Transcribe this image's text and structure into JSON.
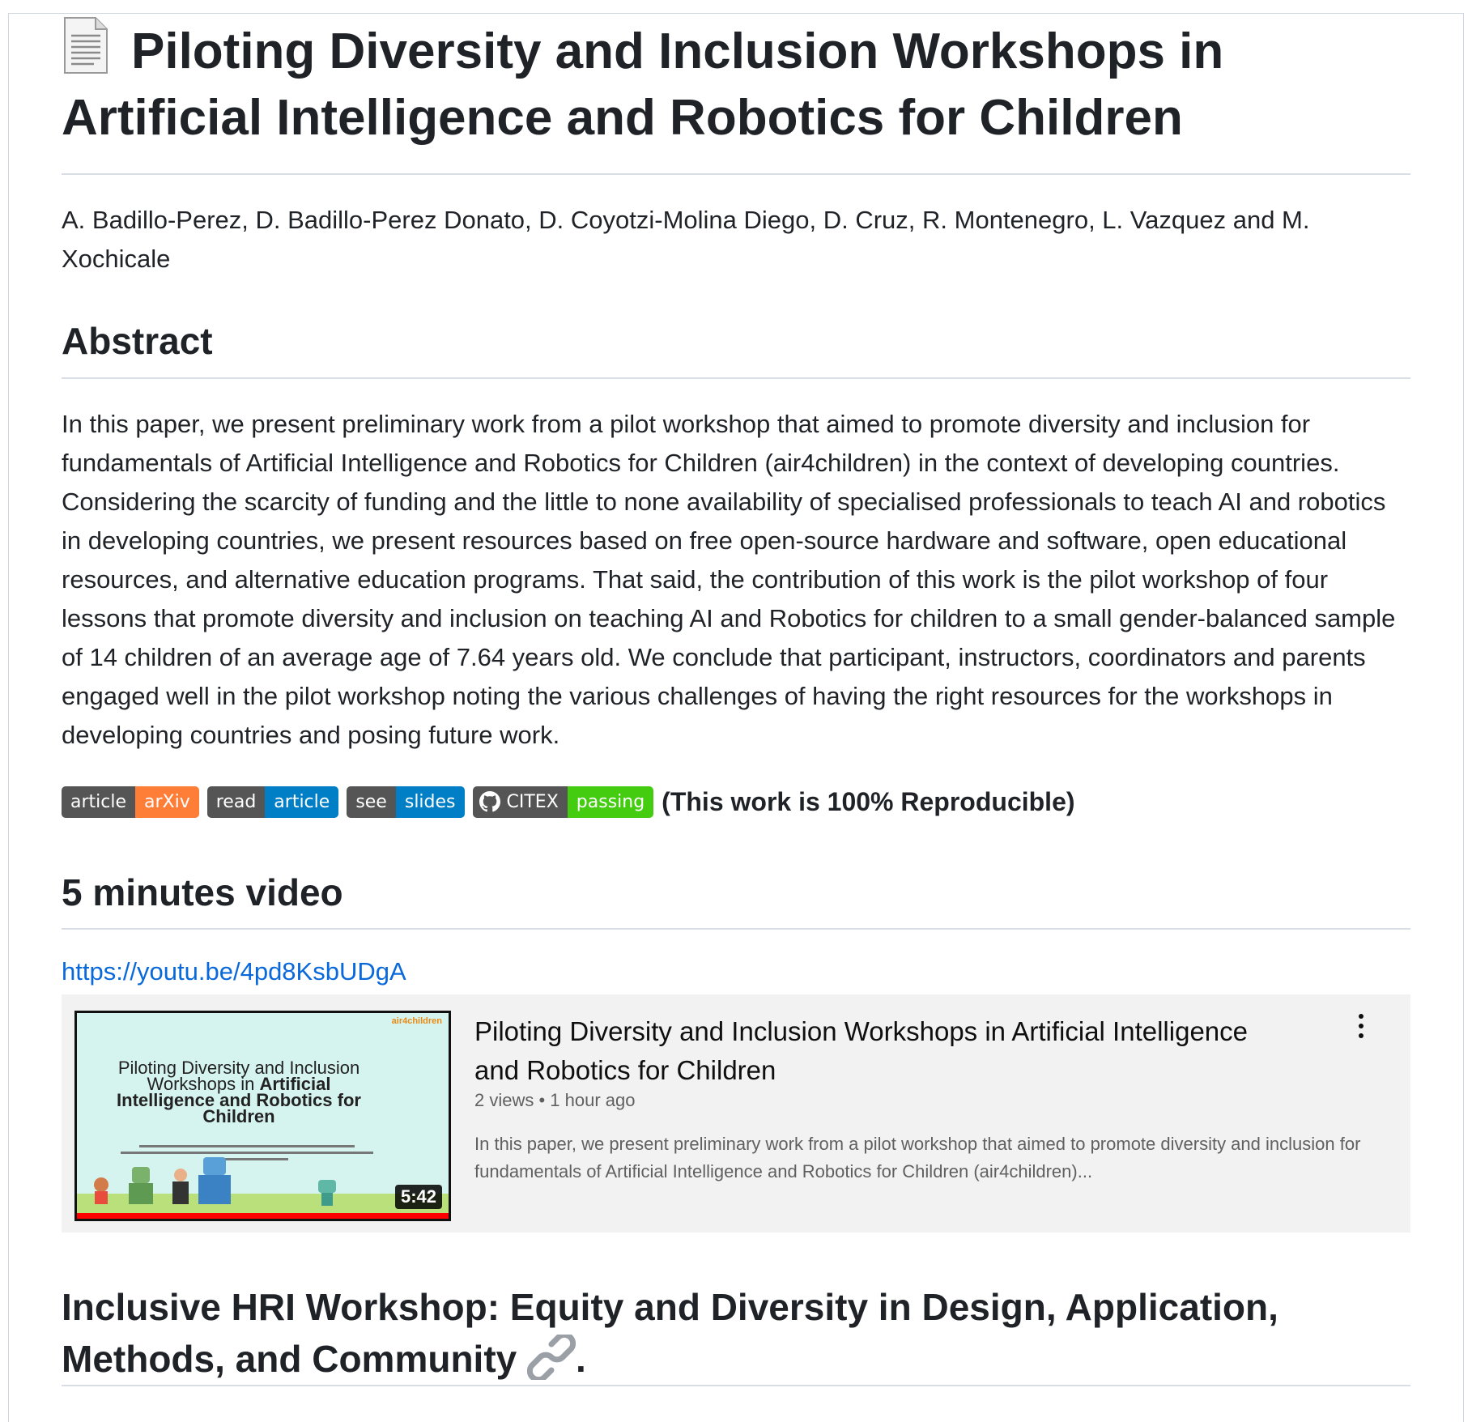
{
  "title": "Piloting Diversity and Inclusion Workshops in Artificial Intelligence and Robotics for Children",
  "title_icon": "page-icon",
  "authors": "A. Badillo-Perez, D. Badillo-Perez Donato, D. Coyotzi-Molina Diego, D. Cruz, R. Montenegro, L. Vazquez and M. Xochicale",
  "abstract_heading": "Abstract",
  "abstract": "In this paper, we present preliminary work from a pilot workshop that aimed to promote diversity and inclusion for fundamentals of Artificial Intelligence and Robotics for Children (air4children) in the context of developing countries. Considering the scarcity of funding and the little to none availability of specialised professionals to teach AI and robotics in developing countries, we present resources based on free open-source hardware and software, open educational resources, and alternative education programs. That said, the contribution of this work is the pilot workshop of four lessons that promote diversity and inclusion on teaching AI and Robotics for children to a small gender-balanced sample of 14 children of an average age of 7.64 years old. We conclude that participant, instructors, coordinators and parents engaged well in the pilot workshop noting the various challenges of having the right resources for the workshops in developing countries and posing future work.",
  "badges": [
    {
      "left": "article",
      "right": "arXiv",
      "color": "#fe7d37"
    },
    {
      "left": "read",
      "right": "article",
      "color": "#007ec6"
    },
    {
      "left": "see",
      "right": "slides",
      "color": "#007ec6"
    },
    {
      "left": "CITEX",
      "right": "passing",
      "color": "#4c1",
      "icon": "github-icon"
    }
  ],
  "reproducible_note": "(This work is 100% Reproducible)",
  "video_heading": "5 minutes video",
  "video_link": "https://youtu.be/4pd8KsbUDgA",
  "video": {
    "title": "Piloting Diversity and Inclusion Workshops in Artificial Intelligence and Robotics for Children",
    "meta": "2 views • 1 hour ago",
    "description": "In this paper, we present preliminary work from a pilot workshop that aimed to promote diversity and inclusion for fundamentals of Artificial Intelligence and Robotics for Children (air4children)...",
    "duration": "5:42",
    "thumb_brand": "air4children",
    "thumb_title_line1": "Piloting Diversity and Inclusion",
    "thumb_title_line2a": "Workshops in ",
    "thumb_title_line2b": "Artificial",
    "thumb_title_line3": "Intelligence and Robotics for",
    "thumb_title_line4": "Children"
  },
  "hri_heading": "Inclusive HRI Workshop: Equity and Diversity in Design, Application, Methods, and Community",
  "hri_suffix": "."
}
